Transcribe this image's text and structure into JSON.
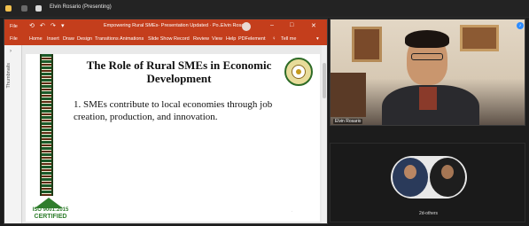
{
  "meeting": {
    "title": "Elvin Rosario (Presenting)"
  },
  "powerpoint": {
    "quick_access": [
      "File",
      "⟲",
      "↶",
      "↷",
      "▾"
    ],
    "document_title": "Empowering Rural SMEs- Presentation Updated  ·  Po...",
    "user_name": "Elvin Rosario",
    "window_controls": [
      "–",
      "□",
      "✕"
    ],
    "ribbon_tabs": [
      "File",
      "Home",
      "Insert",
      "Draw",
      "Design",
      "Transitions",
      "Animations",
      "Slide Show",
      "Record",
      "Review",
      "View",
      "Help",
      "PDFelement"
    ],
    "tell_me": "Tell me",
    "thumbnails_label": "Thumbnails"
  },
  "slide": {
    "heading": "The Role of Rural SMEs in Economic Development",
    "point": "1. SMEs contribute to local economies through job creation, production, and innovation.",
    "iso_line1": "ISO 9001:2015",
    "iso_line2": "CERTIFIED"
  },
  "participants": {
    "presenter_name": "Elvin Rosario",
    "second_tile_name": "2d-others"
  },
  "colors": {
    "powerpoint_red": "#c43e1c",
    "stripe_green": "#1b5a2a",
    "stripe_brown": "#5c2a12",
    "iso_green": "#2f7d2c",
    "zoom_blue": "#2d8cff"
  }
}
